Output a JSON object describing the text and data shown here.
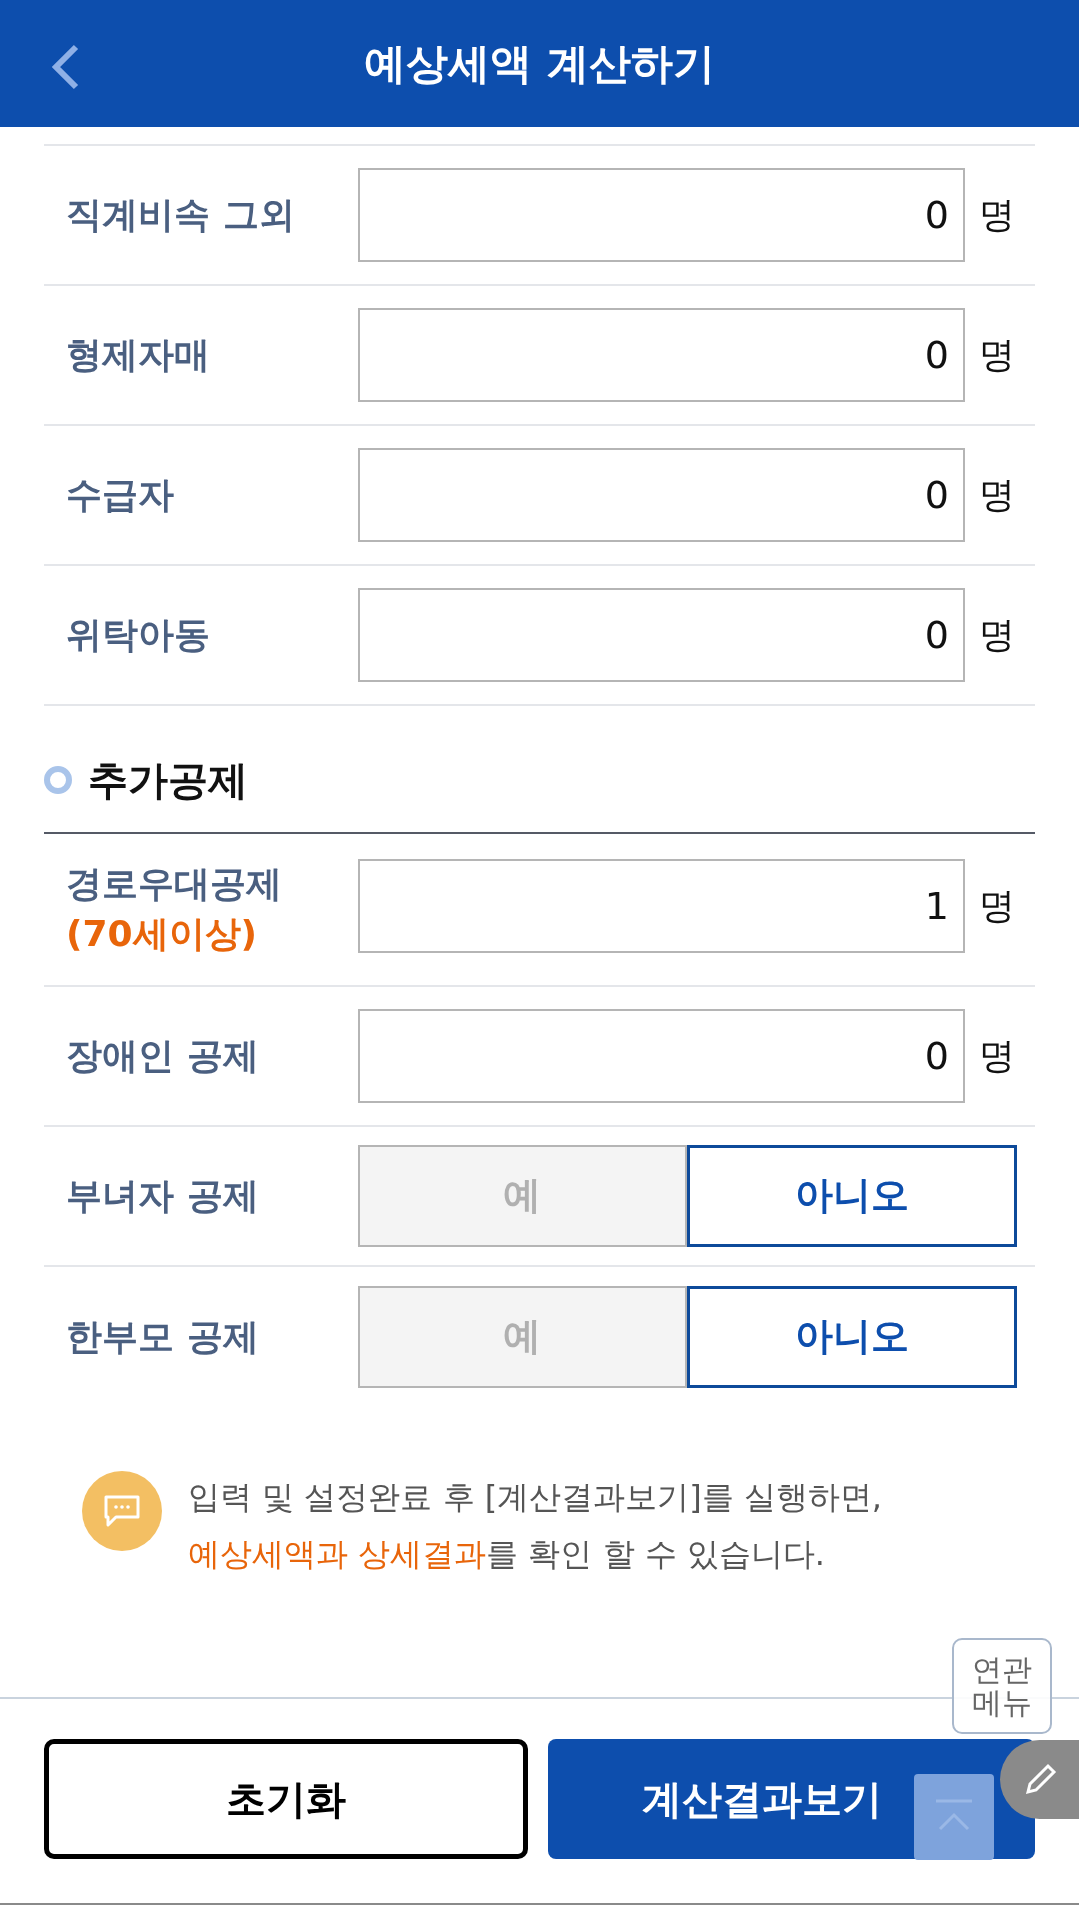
{
  "header": {
    "title": "예상세액 계산하기"
  },
  "rows": [
    {
      "kind": "count",
      "label": "직계비속 그외",
      "value": "0",
      "unit": "명"
    },
    {
      "kind": "count",
      "label": "형제자매",
      "value": "0",
      "unit": "명"
    },
    {
      "kind": "count",
      "label": "수급자",
      "value": "0",
      "unit": "명"
    },
    {
      "kind": "count",
      "label": "위탁아동",
      "value": "0",
      "unit": "명"
    }
  ],
  "section": {
    "title": "추가공제"
  },
  "extra_rows": [
    {
      "kind": "count",
      "label": "경로우대공제",
      "note": "(70세이상)",
      "value": "1",
      "unit": "명"
    },
    {
      "kind": "count",
      "label": "장애인 공제",
      "value": "0",
      "unit": "명"
    },
    {
      "kind": "toggle",
      "label": "부녀자 공제",
      "options": [
        {
          "label": "예",
          "selected": false
        },
        {
          "label": "아니오",
          "selected": true
        }
      ]
    },
    {
      "kind": "toggle",
      "label": "한부모 공제",
      "options": [
        {
          "label": "예",
          "selected": false
        },
        {
          "label": "아니오",
          "selected": true
        }
      ]
    }
  ],
  "notice": {
    "text": "입력 및 설정완료 후 [계산결과보기]를 실행하면,",
    "highlight": "예상세액과 상세결과",
    "rest": "를 확인 할 수 있습니다."
  },
  "buttons": {
    "reset": "초기화",
    "submit": "계산결과보기"
  },
  "floating": {
    "related_menu": "연관메뉴"
  }
}
